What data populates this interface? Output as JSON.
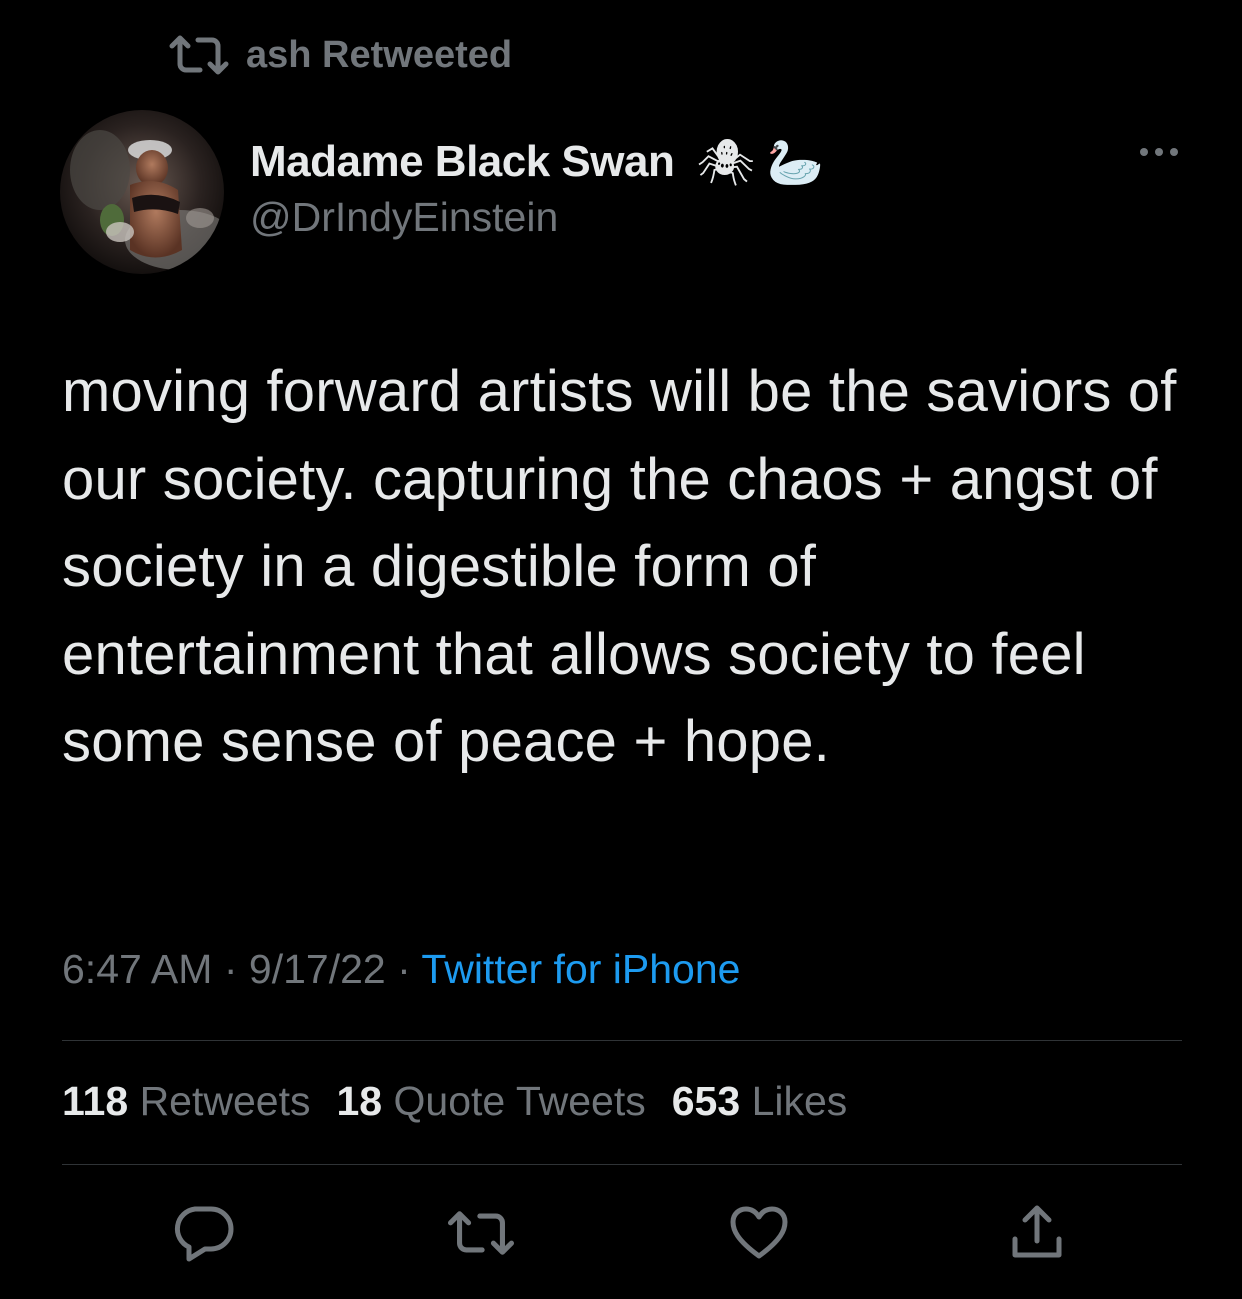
{
  "colors": {
    "background": "#000000",
    "primary_text": "#e7e9ea",
    "secondary_text": "#71767b",
    "link": "#1d9bf0",
    "divider": "#2f3336"
  },
  "retweet_banner": {
    "icon": "retweet-icon",
    "label": "ash Retweeted"
  },
  "author": {
    "avatar": "profile-photo",
    "display_name": "Madame Black Swan",
    "name_emojis": [
      "🕷",
      "🦢"
    ],
    "handle": "@DrIndyEinstein"
  },
  "tweet": {
    "text": "moving forward artists will be the saviors of our society. capturing the chaos + angst of society in a digestible form of entertainment that allows society to feel some sense of peace + hope.",
    "time": "6:47 AM",
    "separator": "·",
    "date": "9/17/22",
    "source": "Twitter for iPhone"
  },
  "stats": {
    "retweets_count": "118",
    "retweets_label": "Retweets",
    "quotes_count": "18",
    "quotes_label": "Quote Tweets",
    "likes_count": "653",
    "likes_label": "Likes"
  },
  "actions": [
    "reply-icon",
    "retweet-icon",
    "like-icon",
    "share-icon"
  ]
}
